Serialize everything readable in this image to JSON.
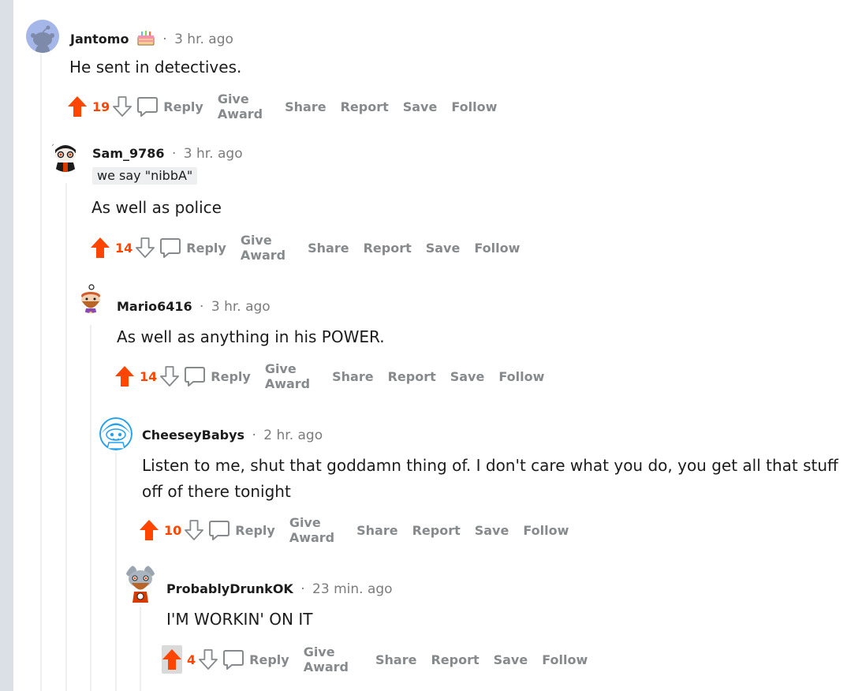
{
  "comments": [
    {
      "author": "Jantomo",
      "time": "3 hr. ago",
      "has_award": true,
      "flair": "",
      "body": "He sent in detectives.",
      "score": "19",
      "upvoted": true,
      "avatar": "snoo-gray-icon"
    },
    {
      "author": "Sam_9786",
      "time": "3 hr. ago",
      "flair": "we say \"nibbA\"",
      "body": "As well as police",
      "score": "14",
      "upvoted": true,
      "avatar": "snoo-glasses-icon"
    },
    {
      "author": "Mario6416",
      "time": "3 hr. ago",
      "flair": "",
      "body": "As well as anything in his POWER.",
      "score": "14",
      "upvoted": true,
      "avatar": "snoo-bearded-icon"
    },
    {
      "author": "CheeseyBabys",
      "time": "2 hr. ago",
      "flair": "",
      "body": "Listen to me, shut that goddamn thing of. I don't care what you do, you get all that stuff off of there tonight",
      "score": "10",
      "upvoted": true,
      "avatar": "snoo-blue-icon"
    },
    {
      "author": "ProbablyDrunkOK",
      "time": "23 min. ago",
      "flair": "",
      "body": "I'M WORKIN' ON IT",
      "score": "4",
      "upvoted": true,
      "avatar": "snoo-koala-icon"
    }
  ],
  "actions": {
    "reply": "Reply",
    "give_award": "Give Award",
    "share": "Share",
    "report": "Report",
    "save": "Save",
    "follow": "Follow"
  },
  "colors": {
    "upvote": "#ff4500",
    "action_text": "#878a8c",
    "thread_line": "#edeff1",
    "page_bg": "#dae0e6"
  }
}
